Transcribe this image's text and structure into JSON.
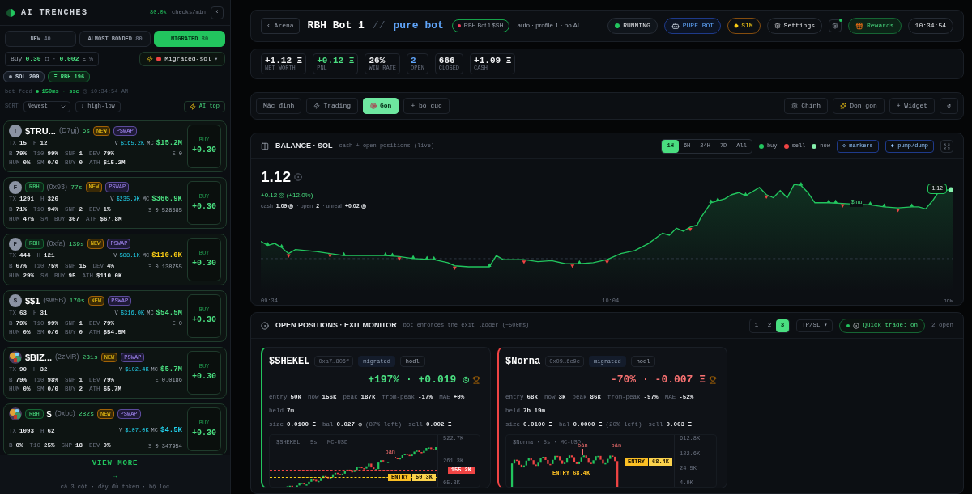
{
  "sidebar": {
    "title": "AI TRENCHES",
    "rate": "80.0k",
    "rate_unit": "checks/min",
    "collapse": "‹",
    "tabs": [
      {
        "label": "NEW",
        "count": "40",
        "selected": false
      },
      {
        "label": "ALMOST BONDED",
        "count": "80",
        "selected": false
      },
      {
        "label": "MIGRATED",
        "count": "80",
        "selected": true
      }
    ],
    "buy": {
      "label": "Buy",
      "amount": "0.30",
      "separator": "·",
      "fee": "0.002",
      "fee_unit": "Ξ",
      "percent": "%"
    },
    "filter": {
      "label": "Migrated-sol",
      "caret": "▾"
    },
    "chips": [
      {
        "label": "SOL 200",
        "kind": "sol"
      },
      {
        "label": "Ξ RBH 196",
        "kind": "rbh"
      }
    ],
    "feed": {
      "label": "bot feed",
      "latency": "150ms · sse",
      "time": "10:34:54 AM"
    },
    "sort": {
      "label": "SORT",
      "value": "Newest",
      "order": "↓ high-low",
      "ai": "AI top"
    },
    "tokens": [
      {
        "avatar": {
          "kind": "letter",
          "text": "T"
        },
        "name": "$TRU...",
        "code": "(D7gj)",
        "age": "6s",
        "badges": [
          {
            "label": "NEW",
            "kind": "new"
          },
          {
            "label": "PSWAP",
            "kind": "pswap"
          }
        ],
        "v_label": "V",
        "volume": "$165.2K",
        "mc_label": "MC",
        "mc": "$15.2M",
        "color": "#4ade80",
        "holding": "Ξ 0",
        "rows": [
          [
            [
              "TX",
              "15"
            ],
            [
              "H",
              "12"
            ]
          ],
          [
            [
              "B",
              "79%"
            ],
            [
              "T10",
              "99%"
            ],
            [
              "SNP",
              "1"
            ],
            [
              "DEV",
              "79%"
            ]
          ],
          [
            [
              "HUM",
              "0%"
            ],
            [
              "SM",
              "0/0"
            ],
            [
              "BUY",
              "0"
            ],
            [
              "ATH",
              "$15.2M"
            ]
          ]
        ],
        "buy_label": "BUY",
        "buy_amount": "+0.30"
      },
      {
        "avatar": {
          "kind": "letter",
          "text": "F"
        },
        "tags": [
          "RBH"
        ],
        "code": "(0x93)",
        "age": "77s",
        "badges": [
          {
            "label": "NEW",
            "kind": "new"
          },
          {
            "label": "PSWAP",
            "kind": "pswap"
          }
        ],
        "v_label": "V",
        "volume": "$235.9K",
        "mc_label": "MC",
        "mc": "$366.9K",
        "color": "#4ade80",
        "holding": "Ξ 0.528585",
        "rows": [
          [
            [
              "TX",
              "1291"
            ],
            [
              "H",
              "326"
            ]
          ],
          [
            [
              "B",
              "71%"
            ],
            [
              "T10",
              "94%"
            ],
            [
              "SNP",
              "2"
            ],
            [
              "DEV",
              "1%"
            ]
          ],
          [
            [
              "HUM",
              "47%"
            ],
            [
              "SM"
            ],
            [
              "BUY",
              "367"
            ],
            [
              "ATH",
              "$67.8M"
            ]
          ]
        ],
        "buy_label": "BUY",
        "buy_amount": "+0.30"
      },
      {
        "avatar": {
          "kind": "letter",
          "text": "P"
        },
        "tags": [
          "RBH"
        ],
        "code": "(0xfa)",
        "age": "139s",
        "badges": [
          {
            "label": "NEW",
            "kind": "new"
          },
          {
            "label": "PSWAP",
            "kind": "pswap"
          }
        ],
        "v_label": "V",
        "volume": "$88.1K",
        "mc_label": "MC",
        "mc": "$110.0K",
        "color": "#facc15",
        "holding": "Ξ 0.138755",
        "rows": [
          [
            [
              "TX",
              "444"
            ],
            [
              "H",
              "121"
            ]
          ],
          [
            [
              "B",
              "67%"
            ],
            [
              "T10",
              "75%"
            ],
            [
              "SNP",
              "15"
            ],
            [
              "DEV",
              "4%"
            ]
          ],
          [
            [
              "HUM",
              "29%"
            ],
            [
              "SM"
            ],
            [
              "BUY",
              "95"
            ],
            [
              "ATH",
              "$110.0K"
            ]
          ]
        ],
        "buy_label": "BUY",
        "buy_amount": "+0.30"
      },
      {
        "avatar": {
          "kind": "letter",
          "text": "$"
        },
        "name": "$$1",
        "code": "(sw5B)",
        "age": "170s",
        "badges": [
          {
            "label": "NEW",
            "kind": "new"
          },
          {
            "label": "PSWAP",
            "kind": "pswap"
          }
        ],
        "v_label": "V",
        "volume": "$316.0K",
        "mc_label": "MC",
        "mc": "$54.5M",
        "color": "#4ade80",
        "holding": "Ξ 0",
        "rows": [
          [
            [
              "TX",
              "63"
            ],
            [
              "H",
              "31"
            ]
          ],
          [
            [
              "B",
              "79%"
            ],
            [
              "T10",
              "99%"
            ],
            [
              "SNP",
              "1"
            ],
            [
              "DEV",
              "79%"
            ]
          ],
          [
            [
              "HUM",
              "0%"
            ],
            [
              "SM",
              "0/0"
            ],
            [
              "BUY",
              "0"
            ],
            [
              "ATH",
              "$54.5M"
            ]
          ]
        ],
        "buy_label": "BUY",
        "buy_amount": "+0.30"
      },
      {
        "avatar": {
          "kind": "picture"
        },
        "name": "$BIZ...",
        "code": "(2zMR)",
        "age": "231s",
        "badges": [
          {
            "label": "NEW",
            "kind": "new"
          },
          {
            "label": "PSWAP",
            "kind": "pswap"
          }
        ],
        "v_label": "V",
        "volume": "$102.4K",
        "mc_label": "MC",
        "mc": "$5.7M",
        "color": "#4ade80",
        "holding": "Ξ 0.0186",
        "rows": [
          [
            [
              "TX",
              "90"
            ],
            [
              "H",
              "32"
            ]
          ],
          [
            [
              "B",
              "79%"
            ],
            [
              "T10",
              "98%"
            ],
            [
              "SNP",
              "1"
            ],
            [
              "DEV",
              "79%"
            ]
          ],
          [
            [
              "HUM",
              "0%"
            ],
            [
              "SM",
              "0/0"
            ],
            [
              "BUY",
              "2"
            ],
            [
              "ATH",
              "$5.7M"
            ]
          ]
        ],
        "buy_label": "BUY",
        "buy_amount": "+0.30"
      },
      {
        "avatar": {
          "kind": "picture"
        },
        "tags": [
          "RBH"
        ],
        "name": "$",
        "code": "(0xbc)",
        "age": "282s",
        "badges": [
          {
            "label": "NEW",
            "kind": "new"
          },
          {
            "label": "PSWAP",
            "kind": "pswap"
          }
        ],
        "v_label": "V",
        "volume": "$107.0K",
        "mc_label": "MC",
        "mc": "$4.5K",
        "color": "#22d3ee",
        "holding": "Ξ 0.347954",
        "rows": [
          [
            [
              "TX",
              "1093"
            ],
            [
              "H",
              "62"
            ]
          ],
          [
            [
              "B",
              "0%"
            ],
            [
              "T10",
              "25%"
            ],
            [
              "SNP",
              "18"
            ],
            [
              "DEV",
              "0%"
            ]
          ]
        ],
        "buy_label": "BUY",
        "buy_amount": "+0.30"
      }
    ],
    "view_more": {
      "label": "VIEW MORE",
      "arrow": "→",
      "note": "cả 3 cột · đầy đủ token · bộ lọc"
    }
  },
  "header": {
    "back": "‹ Arena",
    "bot": "RBH Bot 1",
    "divider": "//",
    "mode": "pure bot",
    "bot_pill": "RBH Bot 1 $SH",
    "profile": "auto · profile 1 · no AI",
    "status": "RUNNING",
    "bot_type": "PURE BOT",
    "sim": "SIM",
    "settings": "Settings",
    "rewards": "Rewards",
    "clock": "10:34:54"
  },
  "stats": [
    {
      "value": "+1.12 Ξ",
      "label": "NET WORTH",
      "kind": "plain"
    },
    {
      "value": "+0.12 Ξ",
      "label": "PNL",
      "kind": "up"
    },
    {
      "value": "26%",
      "label": "WIN RATE",
      "kind": "plain"
    },
    {
      "value": "2",
      "label": "OPEN",
      "kind": "info"
    },
    {
      "value": "666",
      "label": "CLOSED",
      "kind": "plain"
    },
    {
      "value": "+1.09 Ξ",
      "label": "CASH",
      "kind": "plain"
    }
  ],
  "layouts": {
    "left": [
      {
        "label": "Mặc định",
        "kind": "plain",
        "selected": false
      },
      {
        "label": "Trading",
        "kind": "bolt",
        "selected": false
      },
      {
        "label": "Gọn",
        "kind": "target",
        "selected": true
      },
      {
        "label": "+ bố cục",
        "kind": "plain",
        "selected": false
      }
    ],
    "right": [
      {
        "label": "Chỉnh",
        "kind": "gear"
      },
      {
        "label": "Dọn gọn",
        "kind": "sparkle"
      },
      {
        "label": "+ Widget",
        "kind": "plain"
      },
      {
        "label": "↺",
        "kind": "plain"
      }
    ]
  },
  "chart": {
    "title": "BALANCE · SOL",
    "subtitle": "cash + open positions (live)",
    "ranges": [
      {
        "label": "1H",
        "selected": true
      },
      {
        "label": "6H",
        "selected": false
      },
      {
        "label": "24H",
        "selected": false
      },
      {
        "label": "7D",
        "selected": false
      },
      {
        "label": "All",
        "selected": false
      }
    ],
    "legend": [
      {
        "label": "buy",
        "color": "#22c55e"
      },
      {
        "label": "sell",
        "color": "#ef4444"
      },
      {
        "label": "now",
        "color": "#86efac"
      }
    ],
    "markers": "◇ markers",
    "pump": "◆ pump/dump",
    "value": "1.12",
    "change": "+0.12 ◎ (+12.0%)",
    "breakdown": [
      {
        "label": "cash",
        "value": "1.09 ◎"
      },
      {
        "label": "· open",
        "value": "2"
      },
      {
        "label": "· unreal",
        "value": "+0.02 ◎"
      }
    ],
    "end_tag": "1.12",
    "annotation": "$Inu",
    "x_labels": [
      "09:34",
      "10:04",
      "now"
    ]
  },
  "positions": {
    "title": "OPEN POSITIONS · EXIT MONITOR",
    "subtitle": "bot enforces the exit ladder (~500ms)",
    "pages": [
      {
        "label": "1",
        "selected": false
      },
      {
        "label": "2",
        "selected": false
      },
      {
        "label": "3",
        "selected": true
      }
    ],
    "tpsl": "TP/SL ▾",
    "quick_trade": "Quick trade: on",
    "open_count": "2 open",
    "cards": [
      {
        "symbol": "$SHEKEL",
        "address": "0xa7…806f",
        "tags": [
          "migrated",
          "hodl"
        ],
        "kind": "profit",
        "pnl": "+197% · +0.019 ◎",
        "metrics": [
          [
            "entry",
            "50k"
          ],
          [
            "now",
            "156k"
          ],
          [
            "peak",
            "187k"
          ],
          [
            "from-peak",
            "-17%"
          ],
          [
            "MAE",
            "+0%"
          ]
        ],
        "held": [
          [
            "held",
            "7m"
          ]
        ],
        "size": [
          [
            "size",
            "0.0100 Ξ"
          ],
          [
            "bal",
            "0.027 ◎",
            "(87% left)"
          ],
          [
            "sell",
            "0.002 Ξ"
          ]
        ],
        "mini": {
          "title": "$SHEKEL · 5s · MC-USD",
          "ticks": [
            "522.7K",
            "261.3K",
            "65.3K"
          ],
          "price_tag": "155.2K",
          "entry_word": "ENTRY",
          "entry_value": "50.3K",
          "sell_marks": [
            "bán"
          ]
        }
      },
      {
        "symbol": "$Norna",
        "address": "0x09…6c9c",
        "tags": [
          "migrated",
          "hodl"
        ],
        "kind": "loss",
        "pnl": "-70% · -0.007 Ξ",
        "metrics": [
          [
            "entry",
            "68k"
          ],
          [
            "now",
            "3k"
          ],
          [
            "peak",
            "86k"
          ],
          [
            "from-peak",
            "-97%"
          ],
          [
            "MAE",
            "-52%"
          ]
        ],
        "held": [
          [
            "held",
            "7h 19m"
          ]
        ],
        "size": [
          [
            "size",
            "0.0100 Ξ"
          ],
          [
            "bal",
            "0.0000 Ξ",
            "(20% left)"
          ],
          [
            "sell",
            "0.003 Ξ"
          ]
        ],
        "mini": {
          "title": "$Norna · 5s · MC-USD",
          "ticks": [
            "612.8K",
            "122.6K",
            "24.5K",
            "4.9K"
          ],
          "entry_word": "ENTRY",
          "entry_value": "68.4K",
          "sell_marks": [
            "bán",
            "bán"
          ],
          "entry_note": "ENTRY 68.4K"
        }
      }
    ]
  }
}
